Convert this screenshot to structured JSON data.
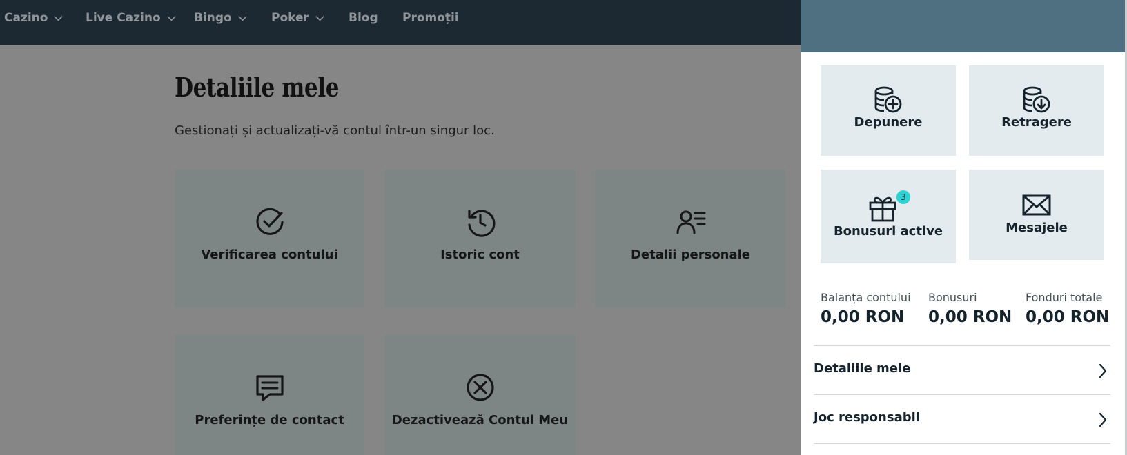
{
  "nav": {
    "items": [
      {
        "label": "Cazino"
      },
      {
        "label": "Live Cazino"
      },
      {
        "label": "Bingo"
      },
      {
        "label": "Poker"
      },
      {
        "label": "Blog"
      },
      {
        "label": "Promoții"
      }
    ]
  },
  "main": {
    "title": "Detaliile mele",
    "subtitle": "Gestionați și actualizați-vă contul într-un singur loc.",
    "cards": [
      {
        "label": "Verificarea contului",
        "icon": "check-circle-icon"
      },
      {
        "label": "Istoric cont",
        "icon": "history-icon"
      },
      {
        "label": "Detalii personale",
        "icon": "person-details-icon"
      },
      {
        "label": "Preferințe de contact",
        "icon": "chat-icon"
      },
      {
        "label": "Dezactivează Contul Meu",
        "icon": "close-circle-icon"
      }
    ]
  },
  "panel": {
    "tiles": [
      {
        "label": "Depunere",
        "icon": "coins-plus-icon"
      },
      {
        "label": "Retragere",
        "icon": "coins-download-icon"
      },
      {
        "label": "Bonusuri active",
        "icon": "gift-icon",
        "badge": "3"
      },
      {
        "label": "Mesajele",
        "icon": "envelope-icon"
      }
    ],
    "balances": [
      {
        "label": "Balanța contului",
        "value": "0,00 RON"
      },
      {
        "label": "Bonusuri",
        "value": "0,00 RON"
      },
      {
        "label": "Fonduri totale",
        "value": "0,00 RON"
      }
    ],
    "links": [
      {
        "label": "Detaliile mele"
      },
      {
        "label": "Joc responsabil"
      }
    ]
  },
  "colors": {
    "nav_bg": "#1c2832",
    "overlay_bg": "#868686",
    "card_bg": "#7d8585",
    "panel_header": "#4e7081",
    "tile_bg": "#e4ebee",
    "badge": "#2ed3d3"
  }
}
